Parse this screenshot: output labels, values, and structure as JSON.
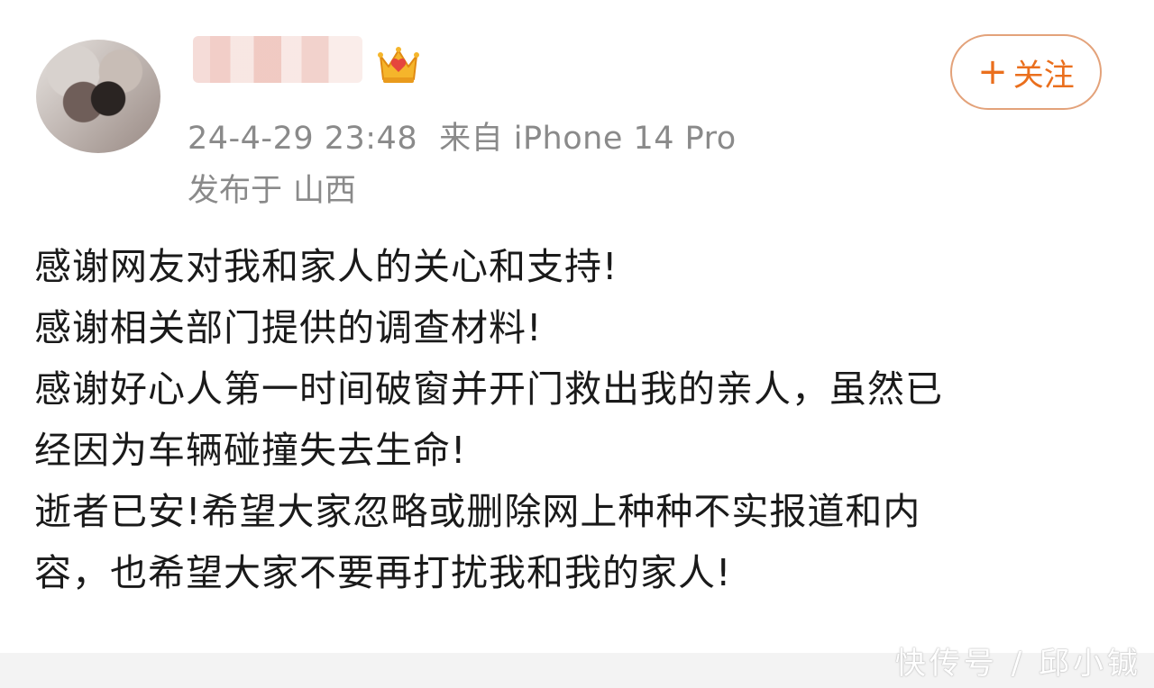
{
  "post": {
    "timestamp": "24-4-29 23:48",
    "source": "来自 iPhone 14 Pro",
    "location_prefix": "发布于",
    "location": "山西",
    "follow_label": "关注",
    "follow_icon": "plus-icon",
    "badge_icon": "crown-icon",
    "lines": [
      "感谢网友对我和家人的关心和支持!",
      "感谢相关部门提供的调查材料!",
      "感谢好心人第一时间破窗并开门救出我的亲人，虽然已",
      "经因为车辆碰撞失去生命!",
      "逝者已安!希望大家忽略或删除网上种种不实报道和内",
      "容，也希望大家不要再打扰我和我的家人!"
    ]
  },
  "watermark": "快传号 / 邱小铖",
  "colors": {
    "accent": "#ea6f1d",
    "meta_text": "#8a8a8a",
    "body_text": "#1a1a1a"
  }
}
